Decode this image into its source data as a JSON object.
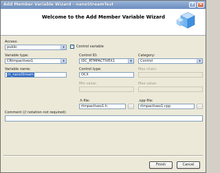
{
  "window": {
    "title": "Add Member Variable Wizard - nanoStreamTest",
    "help_label": "?",
    "close_label": "×"
  },
  "header": {
    "title": "Welcome to the Add Member Variable Wizard",
    "icon": "wizard-cube-icon"
  },
  "access": {
    "label": "Access:",
    "value": "public"
  },
  "control_variable": {
    "label": "Control variable",
    "checked": true
  },
  "variable_type": {
    "label": "Variable type:",
    "value": "CRtmpactivex1"
  },
  "control_id": {
    "label": "Control ID:",
    "value": "IDC_RTMPACTIVEX1"
  },
  "category": {
    "label": "Category:",
    "value": "Control"
  },
  "variable_name": {
    "label": "Variable name:",
    "value": "m_nanoStream"
  },
  "control_type": {
    "label": "Control type:",
    "value": "OCX"
  },
  "max_chars": {
    "label": "Max chars:",
    "value": ""
  },
  "min_value": {
    "label": "Min value:",
    "value": ""
  },
  "max_value": {
    "label": "Max value:",
    "value": ""
  },
  "h_file": {
    "label": ".h file:",
    "value": "rtmpactivex1.h",
    "browse_label": "..."
  },
  "cpp_file": {
    "label": ".cpp file:",
    "value": "rtmpactivex1.cpp",
    "browse_label": "..."
  },
  "comment": {
    "label": "Comment (// notation not required):",
    "value": ""
  },
  "buttons": {
    "finish": "Finish",
    "cancel": "Cancel"
  }
}
